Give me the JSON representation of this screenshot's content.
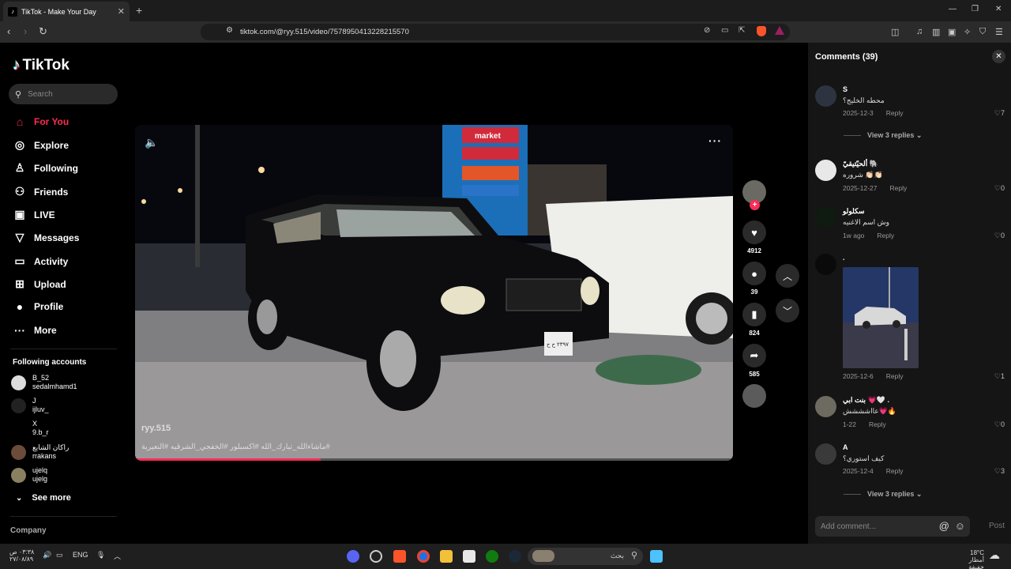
{
  "browser": {
    "tab_title": "TikTok - Make Your Day",
    "url": "tiktok.com/@ryy.515/video/7578950413228215570"
  },
  "sidebar": {
    "logo": "TikTok",
    "search_placeholder": "Search",
    "nav": [
      {
        "label": "For You",
        "icon": "home-icon"
      },
      {
        "label": "Explore",
        "icon": "compass-icon"
      },
      {
        "label": "Following",
        "icon": "following-icon"
      },
      {
        "label": "Friends",
        "icon": "friends-icon"
      },
      {
        "label": "LIVE",
        "icon": "live-icon"
      },
      {
        "label": "Messages",
        "icon": "messages-icon"
      },
      {
        "label": "Activity",
        "icon": "activity-icon"
      },
      {
        "label": "Upload",
        "icon": "upload-icon"
      },
      {
        "label": "Profile",
        "icon": "profile-icon"
      },
      {
        "label": "More",
        "icon": "more-icon"
      }
    ],
    "following_title": "Following accounts",
    "following": [
      {
        "name": "B_52",
        "handle": "sedalmhamd1"
      },
      {
        "name": "J",
        "handle": "ijluv_"
      },
      {
        "name": "X",
        "handle": "9.b_r"
      },
      {
        "name": "راكان الشايع",
        "handle": "rrakans"
      },
      {
        "name": "ujelq",
        "handle": "ujelg"
      }
    ],
    "see_more": "See more",
    "company": "Company"
  },
  "video": {
    "author": "ryy.515",
    "caption": "#ماشاءالله_تبارك_الله #اكسبلور #الخفجي_الشرقيه #النعيرية",
    "progress": 0.31,
    "likes": "4912",
    "comments": "39",
    "saves": "824",
    "shares": "585",
    "sign_text": "market",
    "plate": "٢٣٩٧ ح ح"
  },
  "comments_panel": {
    "title": "Comments",
    "count": "(39)",
    "items": [
      {
        "user": "S",
        "text": "محطه الخليج؟",
        "date": "2025-12-3",
        "reply": "Reply",
        "likes": "7",
        "view_replies": "View 3 replies"
      },
      {
        "user": "ألحيّتيقيّ 🐘",
        "text": "شروره 👏🏻👏🏻",
        "date": "2025-12-27",
        "reply": "Reply",
        "likes": "0"
      },
      {
        "user": "سكلولو",
        "text": "وش اسم الاغنيه",
        "date": "1w ago",
        "reply": "Reply",
        "likes": "0"
      },
      {
        "user": ".",
        "text": "",
        "date": "2025-12-6",
        "reply": "Reply",
        "likes": "1"
      },
      {
        "user": "بنت ابي 💗🤍 .",
        "text": "عااشششش💗🔥",
        "date": "1-22",
        "reply": "Reply",
        "likes": "0"
      },
      {
        "user": "A",
        "text": "كيف استوري؟",
        "date": "2025-12-4",
        "reply": "Reply",
        "likes": "3",
        "view_replies": "View 3 replies"
      }
    ],
    "add_placeholder": "Add comment...",
    "post": "Post"
  },
  "taskbar": {
    "search_placeholder": "بحث",
    "lang": "ENG",
    "time": "٠٣:٣٨ ص",
    "date": "٢٧/٠٨/٨٩",
    "weather_temp": "18°C",
    "weather_text": "أمطار خفيفة"
  }
}
